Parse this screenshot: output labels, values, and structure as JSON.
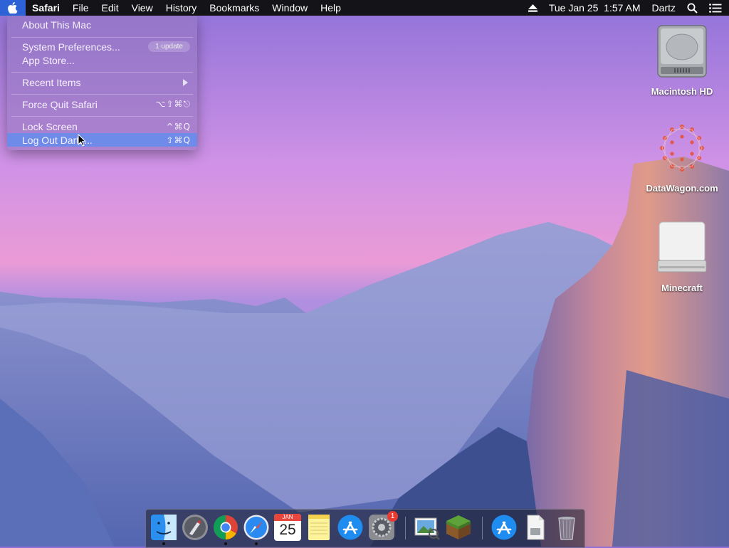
{
  "menubar": {
    "app_name": "Safari",
    "menus": [
      "File",
      "Edit",
      "View",
      "History",
      "Bookmarks",
      "Window",
      "Help"
    ],
    "clock": "Tue Jan 25  1:57 AM",
    "user": "Dartz",
    "icons": [
      "apple-icon",
      "eject-icon",
      "spotlight-search-icon",
      "notification-center-icon"
    ]
  },
  "apple_menu": {
    "about": "About This Mac",
    "system_prefs": "System Preferences...",
    "update_badge": "1 update",
    "app_store": "App Store...",
    "recent_items": "Recent Items",
    "force_quit": "Force Quit Safari",
    "force_quit_shortcut": "⌥⇧⌘⎋",
    "lock_screen": "Lock Screen",
    "lock_screen_shortcut": "^⌘Q",
    "log_out": "Log Out Dartz...",
    "log_out_shortcut": "⇧⌘Q"
  },
  "desktop": {
    "items": [
      {
        "label": "Macintosh HD",
        "icon": "hard-drive-icon"
      },
      {
        "label": "DataWagon.com",
        "icon": "datawagon-logo-icon"
      },
      {
        "label": "Minecraft",
        "icon": "external-drive-icon"
      }
    ]
  },
  "dock": {
    "items": [
      {
        "name": "Finder",
        "icon": "finder-icon"
      },
      {
        "name": "Launchpad",
        "icon": "launchpad-icon"
      },
      {
        "name": "Google Chrome",
        "icon": "chrome-icon"
      },
      {
        "name": "Safari",
        "icon": "safari-icon"
      },
      {
        "name": "Calendar",
        "icon": "calendar-icon",
        "month": "JAN",
        "day": "25"
      },
      {
        "name": "Notes",
        "icon": "notes-icon"
      },
      {
        "name": "App Store",
        "icon": "app-store-icon"
      },
      {
        "name": "System Preferences",
        "icon": "system-preferences-icon",
        "badge": "1"
      },
      {
        "name": "Preview",
        "icon": "preview-icon"
      },
      {
        "name": "Minecraft",
        "icon": "minecraft-icon"
      },
      {
        "name": "App Store Downloads",
        "icon": "downloads-app-store-icon"
      },
      {
        "name": "Document",
        "icon": "document-icon"
      },
      {
        "name": "Trash",
        "icon": "trash-icon"
      }
    ]
  },
  "colors": {
    "menubar_bg": "#141418",
    "menu_highlight": "#6f8bea",
    "accent_blue": "#2e63d8"
  }
}
